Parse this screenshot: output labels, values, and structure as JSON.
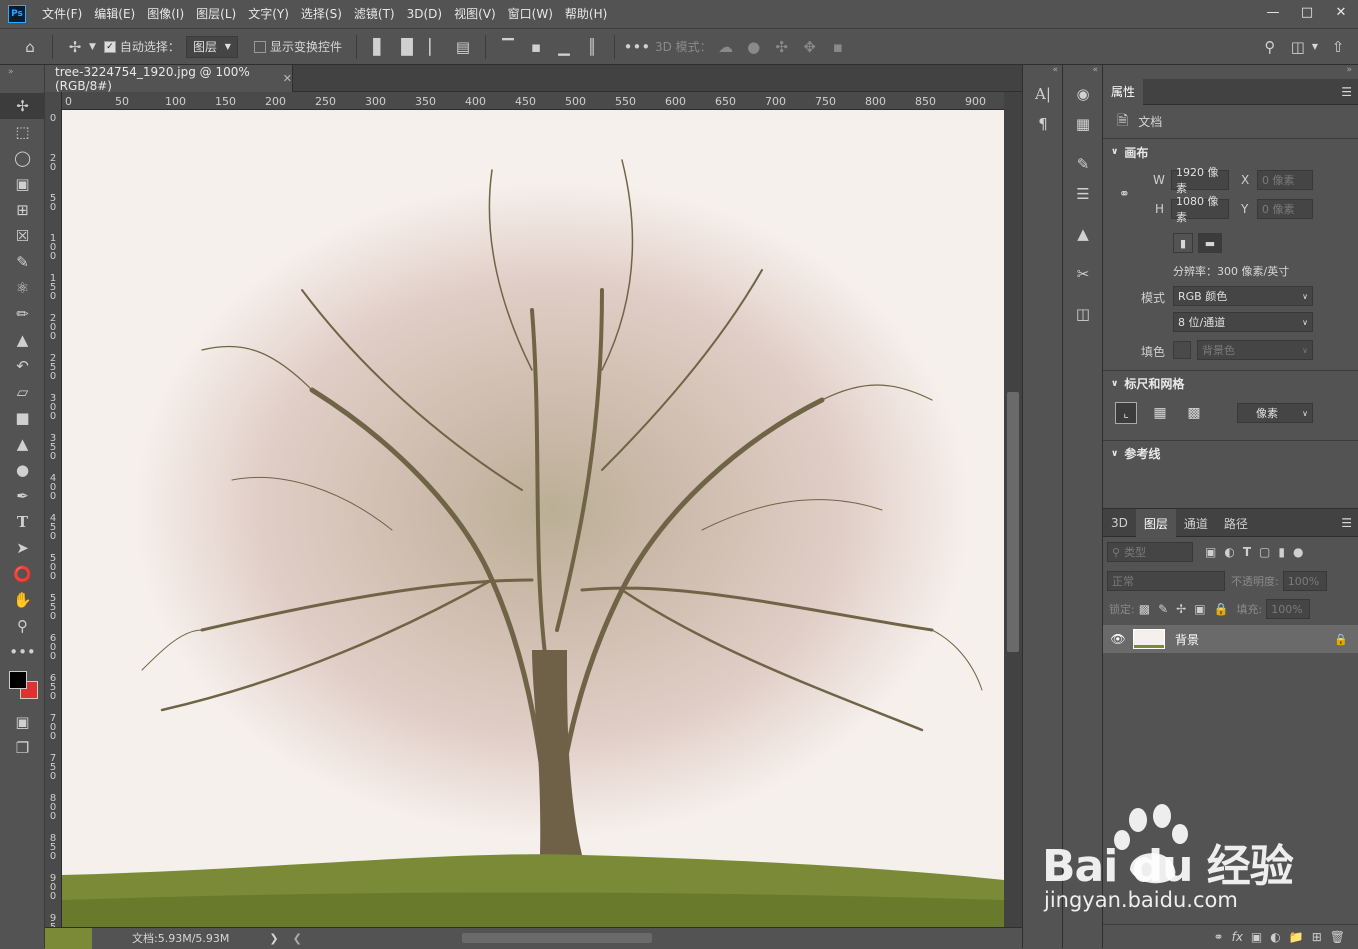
{
  "app": {
    "logo": "Ps"
  },
  "menu": [
    "文件(F)",
    "编辑(E)",
    "图像(I)",
    "图层(L)",
    "文字(Y)",
    "选择(S)",
    "滤镜(T)",
    "3D(D)",
    "视图(V)",
    "窗口(W)",
    "帮助(H)"
  ],
  "options": {
    "auto_select_label": "自动选择：",
    "auto_select_target": "图层",
    "show_transform_label": "显示变换控件",
    "mode_3d_label": "3D 模式："
  },
  "document": {
    "tab_title": "tree-3224754_1920.jpg @ 100%(RGB/8#)",
    "status": "文档:5.93M/5.93M"
  },
  "ruler": {
    "h": [
      "0",
      "50",
      "100",
      "150",
      "200",
      "250",
      "300",
      "350",
      "400",
      "450",
      "500",
      "550",
      "600",
      "650",
      "700",
      "750",
      "800",
      "850",
      "900"
    ],
    "v": [
      "0",
      "20",
      "50",
      "100",
      "150",
      "200",
      "250",
      "300",
      "350",
      "400",
      "450",
      "500",
      "550",
      "600",
      "650",
      "700",
      "750",
      "800",
      "850",
      "900",
      "950"
    ]
  },
  "properties": {
    "tab": "属性",
    "doc_label": "文档",
    "canvas_section": "画布",
    "w_label": "W",
    "w_value": "1920 像素",
    "h_label": "H",
    "h_value": "1080 像素",
    "x_label": "X",
    "x_placeholder": "0 像素",
    "y_label": "Y",
    "y_placeholder": "0 像素",
    "resolution": "分辨率：300 像素/英寸",
    "mode_label": "模式",
    "mode_value": "RGB 颜色",
    "depth_value": "8 位/通道",
    "fill_label": "填色",
    "fill_value": "背景色",
    "rulers_section": "标尺和网格",
    "unit_value": "像素",
    "guides_section": "参考线"
  },
  "layers": {
    "tabs": [
      "3D",
      "图层",
      "通道",
      "路径"
    ],
    "filter_placeholder": "类型",
    "blend_mode": "正常",
    "opacity_label": "不透明度:",
    "opacity_value": "100%",
    "lock_label": "锁定:",
    "fill_label": "填充:",
    "fill_value": "100%",
    "layer_name": "背景"
  },
  "watermark": {
    "brand": "Bai du 经验",
    "url": "jingyan.baidu.com"
  },
  "colors": {
    "accent": "#31a8ff",
    "ui_bg": "#535353",
    "canvas_bg": "#f6f0ec",
    "grass": "#7a8a36",
    "foreground": "#000000",
    "background": "#e03030"
  }
}
